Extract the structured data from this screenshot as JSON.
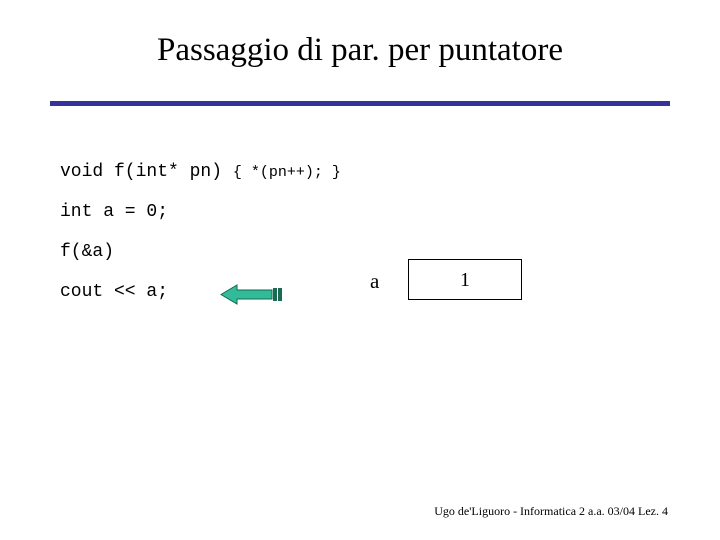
{
  "slide": {
    "title": "Passaggio di par. per puntatore",
    "divider_color": "#333399",
    "background_color": "#ffffff"
  },
  "code": {
    "line1_main": "void f(int* pn) ",
    "line1_tail": "{ *(pn++); }",
    "line2": "int a = 0;",
    "line3": "f(&a)",
    "line4": "cout << a;"
  },
  "arrow": {
    "name": "left-arrow",
    "direction": "left",
    "fill_color": "#33bb99",
    "outline_color": "#006644",
    "tail_color": "#1a6b52"
  },
  "diagram": {
    "variable_label": "a",
    "cell_value": "1",
    "cell_border_color": "#000000"
  },
  "footer": {
    "text": "Ugo de'Liguoro - Informatica 2 a.a. 03/04 Lez. 4"
  }
}
